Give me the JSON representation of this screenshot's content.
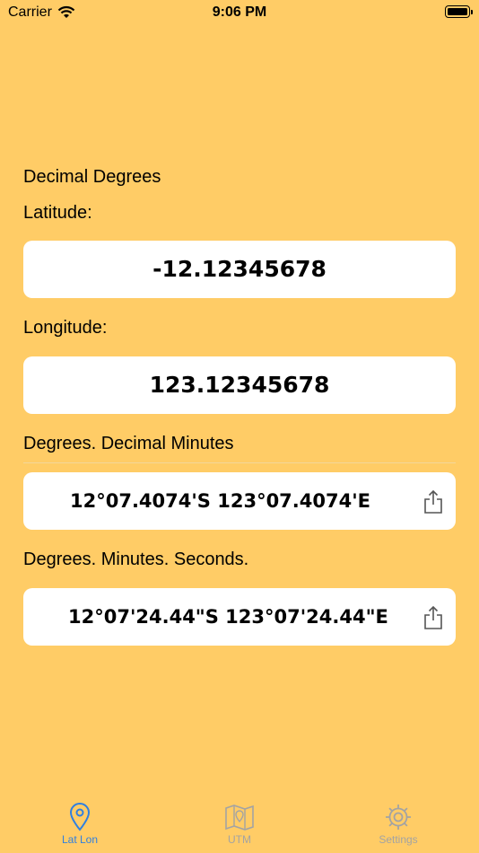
{
  "status": {
    "carrier": "Carrier",
    "time": "9:06 PM"
  },
  "sections": {
    "decimal_degrees": "Decimal Degrees",
    "latitude_label": "Latitude:",
    "latitude_value": "-12.12345678",
    "longitude_label": "Longitude:",
    "longitude_value": "123.12345678",
    "ddm_label": "Degrees. Decimal Minutes",
    "ddm_value": "12°07.4074'S 123°07.4074'E",
    "dms_label": "Degrees. Minutes. Seconds.",
    "dms_value": "12°07'24.44\"S 123°07'24.44\"E"
  },
  "tabs": [
    {
      "label": "Lat Lon",
      "icon": "location-pin-icon",
      "active": true
    },
    {
      "label": "UTM",
      "icon": "map-icon",
      "active": false
    },
    {
      "label": "Settings",
      "icon": "gear-icon",
      "active": false
    }
  ],
  "colors": {
    "background": "#FFCC66",
    "active_tab": "#2F7FE0",
    "inactive_tab": "#A3A3A3"
  }
}
